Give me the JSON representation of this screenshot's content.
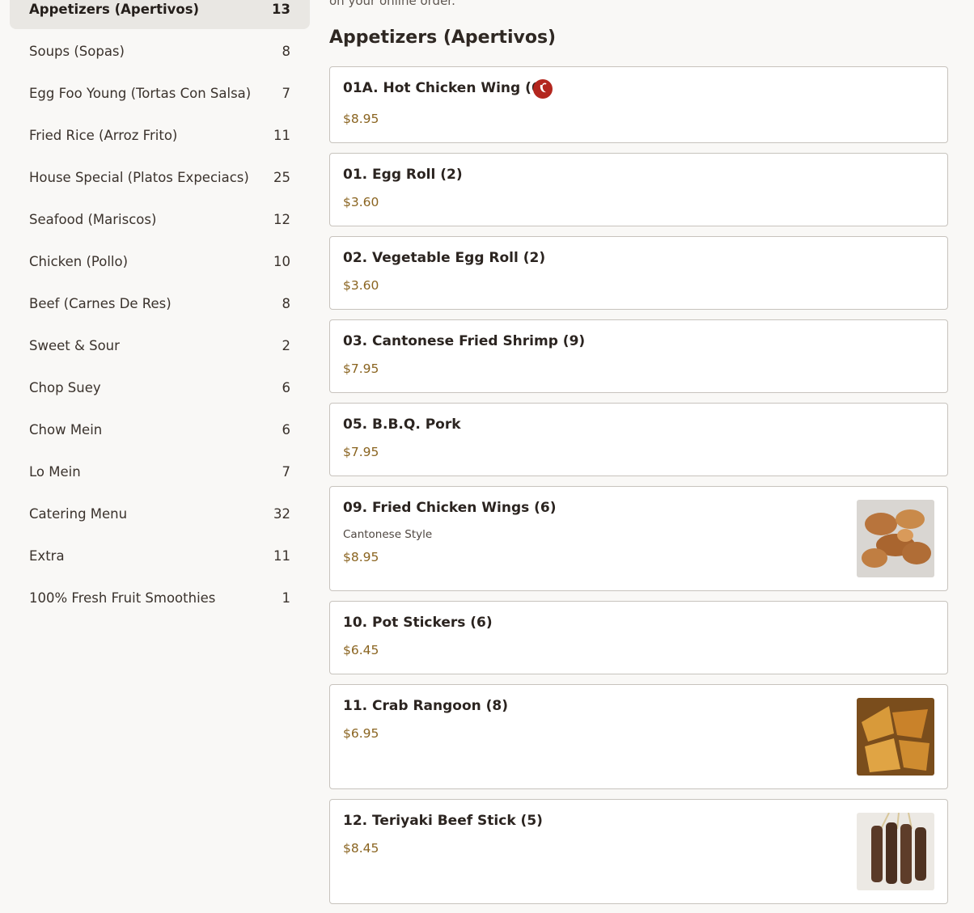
{
  "intro_text": "on your online order.",
  "categories": [
    {
      "label": "Appetizers (Apertivos)",
      "count": "13"
    },
    {
      "label": "Soups (Sopas)",
      "count": "8"
    },
    {
      "label": "Egg Foo Young (Tortas Con Salsa)",
      "count": "7"
    },
    {
      "label": "Fried Rice (Arroz Frito)",
      "count": "11"
    },
    {
      "label": "House Special (Platos Expeciacs)",
      "count": "25"
    },
    {
      "label": "Seafood (Mariscos)",
      "count": "12"
    },
    {
      "label": "Chicken (Pollo)",
      "count": "10"
    },
    {
      "label": "Beef (Carnes De Res)",
      "count": "8"
    },
    {
      "label": "Sweet & Sour",
      "count": "2"
    },
    {
      "label": "Chop Suey",
      "count": "6"
    },
    {
      "label": "Chow Mein",
      "count": "6"
    },
    {
      "label": "Lo Mein",
      "count": "7"
    },
    {
      "label": "Catering Menu",
      "count": "32"
    },
    {
      "label": "Extra",
      "count": "11"
    },
    {
      "label": "100% Fresh Fruit Smoothies",
      "count": "1"
    }
  ],
  "section": {
    "title": "Appetizers (Apertivos)"
  },
  "items": [
    {
      "name": "01A. Hot Chicken Wing (6)",
      "price": "$8.95",
      "icon": "spicy-pepper-icon"
    },
    {
      "name": "01. Egg Roll (2)",
      "price": "$3.60"
    },
    {
      "name": "02. Vegetable Egg Roll (2)",
      "price": "$3.60"
    },
    {
      "name": "03. Cantonese Fried Shrimp (9)",
      "price": "$7.95"
    },
    {
      "name": "05. B.B.Q. Pork",
      "price": "$7.95"
    },
    {
      "name": "09. Fried Chicken Wings (6)",
      "description": "Cantonese Style",
      "price": "$8.95",
      "image": "fried-chicken-wings-photo"
    },
    {
      "name": "10. Pot Stickers (6)",
      "price": "$6.45"
    },
    {
      "name": "11. Crab Rangoon (8)",
      "price": "$6.95",
      "image": "crab-rangoon-photo"
    },
    {
      "name": "12. Teriyaki Beef Stick (5)",
      "price": "$8.45",
      "image": "teriyaki-beef-stick-photo"
    }
  ],
  "colors": {
    "accent_price": "#8a6420",
    "spicy_badge": "#b3261e",
    "active_bg": "#e9e7e3"
  }
}
